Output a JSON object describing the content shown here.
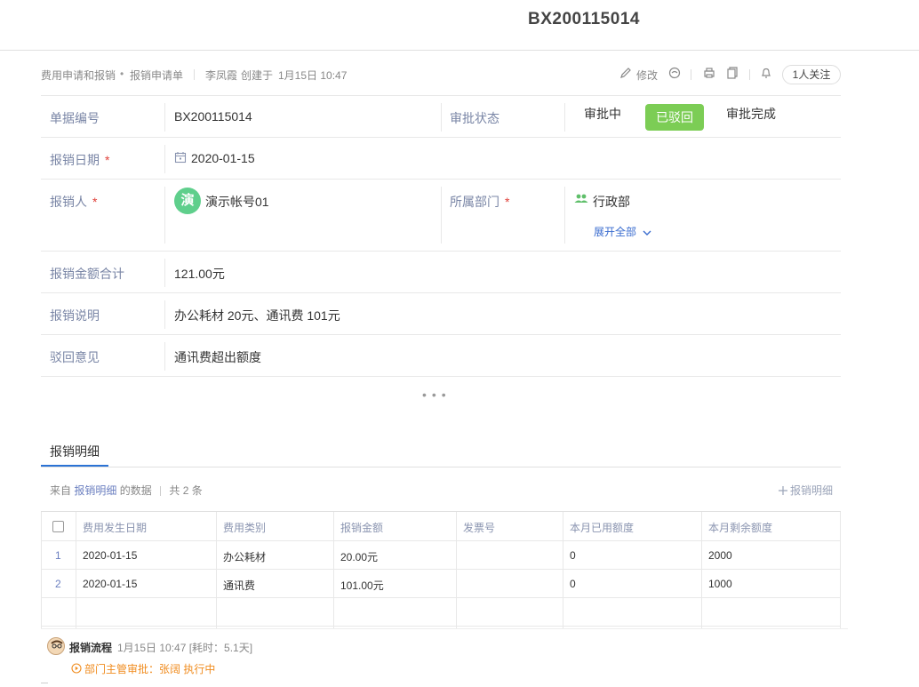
{
  "header": {
    "title": "BX200115014"
  },
  "meta": {
    "breadcrumb_app": "费用申请和报销",
    "breadcrumb_sheet": "报销申请单",
    "creator": "李凤霞",
    "created_text": "创建于",
    "created_time": "1月15日 10:47",
    "edit_label": "修改",
    "follow_label": "1人关注"
  },
  "form": {
    "doc_no": {
      "label": "单据编号",
      "value": "BX200115014"
    },
    "approval": {
      "label": "审批状态",
      "steps": [
        "审批中",
        "已驳回",
        "审批完成"
      ]
    },
    "date": {
      "label": "报销日期",
      "value": "2020-01-15"
    },
    "person": {
      "label": "报销人",
      "avatar_char": "演",
      "value": "演示帐号01"
    },
    "dept": {
      "label": "所属部门",
      "value": "行政部",
      "expand_label": "展开全部"
    },
    "amount": {
      "label": "报销金额合计",
      "value": "121.00元"
    },
    "desc": {
      "label": "报销说明",
      "value": "办公耗材 20元、通讯费 101元"
    },
    "reject": {
      "label": "驳回意见",
      "value": "通讯费超出额度"
    },
    "required_mark": "*"
  },
  "tabs": [
    {
      "label": "报销明细"
    }
  ],
  "detail": {
    "source_prefix": "来自",
    "source_link": "报销明细",
    "source_suffix": "的数据",
    "count_text": "共 2 条",
    "add_label": "报销明细",
    "columns": [
      "费用发生日期",
      "费用类别",
      "报销金额",
      "发票号",
      "本月已用额度",
      "本月剩余额度"
    ],
    "rows": [
      {
        "num": "1",
        "date": "2020-01-15",
        "category": "办公耗材",
        "amount": "20.00元",
        "invoice": "",
        "used": "0",
        "remaining": "2000"
      },
      {
        "num": "2",
        "date": "2020-01-15",
        "category": "通讯费",
        "amount": "101.00元",
        "invoice": "",
        "used": "0",
        "remaining": "1000"
      }
    ]
  },
  "flow": {
    "title": "报销流程",
    "time": "1月15日 10:47 [耗时：5.1天]",
    "step": "部门主管审批：张阔 执行中"
  },
  "colors": {
    "accent": "#2b73d5",
    "rejected": "#7ccd55",
    "warning": "#f08c1f",
    "required": "#e0413a"
  }
}
